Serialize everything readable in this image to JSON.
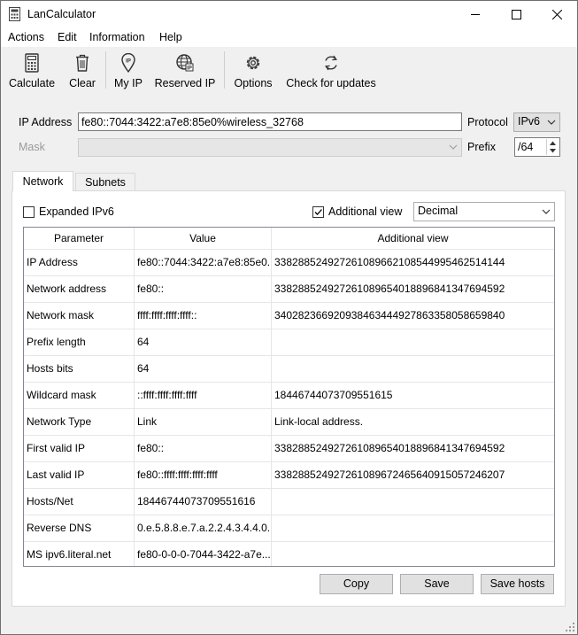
{
  "window": {
    "title": "LanCalculator"
  },
  "menu": [
    "Actions",
    "Edit",
    "Information",
    "Help"
  ],
  "toolbar": {
    "calculate": "Calculate",
    "clear": "Clear",
    "my_ip": "My IP",
    "reserved_ip": "Reserved IP",
    "options": "Options",
    "check_updates": "Check for updates"
  },
  "form": {
    "ip_label": "IP Address",
    "ip_value": "fe80::7044:3422:a7e8:85e0%wireless_32768",
    "protocol_label": "Protocol",
    "protocol_value": "IPv6",
    "mask_label": "Mask",
    "prefix_label": "Prefix",
    "prefix_value": "/64"
  },
  "tabs": [
    "Network",
    "Subnets"
  ],
  "options": {
    "expanded_ipv6": "Expanded IPv6",
    "expanded_checked": false,
    "additional_view": "Additional view",
    "additional_checked": true,
    "view_format": "Decimal"
  },
  "table": {
    "headers": [
      "Parameter",
      "Value",
      "Additional view"
    ],
    "rows": [
      [
        "IP Address",
        "fe80::7044:3422:a7e8:85e0...",
        "338288524927261089662108544995462514144"
      ],
      [
        "Network address",
        "fe80::",
        "338288524927261089654018896841347694592"
      ],
      [
        "Network mask",
        "ffff:ffff:ffff:ffff::",
        "340282366920938463444927863358058659840"
      ],
      [
        "Prefix length",
        "64",
        ""
      ],
      [
        "Hosts bits",
        "64",
        ""
      ],
      [
        "Wildcard mask",
        "::ffff:ffff:ffff:ffff",
        "18446744073709551615"
      ],
      [
        "Network Type",
        "Link",
        "Link-local address."
      ],
      [
        "First valid IP",
        "fe80::",
        "338288524927261089654018896841347694592"
      ],
      [
        "Last valid IP",
        "fe80::ffff:ffff:ffff:ffff",
        "338288524927261089672465640915057246207"
      ],
      [
        "Hosts/Net",
        "18446744073709551616",
        ""
      ],
      [
        "Reverse DNS",
        "0.e.5.8.8.e.7.a.2.2.4.3.4.4.0....",
        ""
      ],
      [
        "MS ipv6.literal.net",
        "fe80-0-0-0-7044-3422-a7e...",
        ""
      ]
    ]
  },
  "buttons": {
    "copy": "Copy",
    "save": "Save",
    "save_hosts": "Save hosts"
  }
}
